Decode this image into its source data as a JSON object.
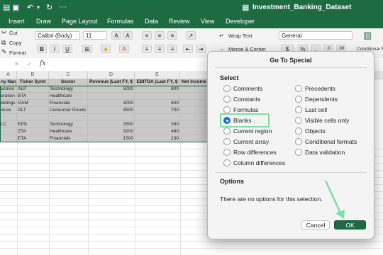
{
  "window": {
    "title": "Investment_Banking_Dataset"
  },
  "menu": [
    "Insert",
    "Draw",
    "Page Layout",
    "Formulas",
    "Data",
    "Review",
    "View",
    "Developer"
  ],
  "ribbon": {
    "clipboard": {
      "cut": "Cut",
      "copy": "Copy",
      "format": "Format"
    },
    "font_name": "Calibri (Body)",
    "font_size": "11",
    "bold": "B",
    "italic": "I",
    "underline": "U",
    "wrap_text": "Wrap Text",
    "merge_center": "Merge & Center",
    "number_format": "General",
    "percent": "%",
    "conditional_formatting": "Conditional Formatting"
  },
  "formula_bar": {
    "fx": "fx",
    "value": ""
  },
  "columns": [
    "A",
    "B",
    "C",
    "D",
    "E"
  ],
  "sheet": {
    "headers": [
      "ny Nan",
      "Ticker Symt",
      "Sector",
      "Revenue (Last FY, $",
      "EBITDA (Last FY, $",
      "Net Income"
    ],
    "rows": [
      [
        "ustries",
        "ALP",
        "Technology",
        "5000",
        "800",
        ""
      ],
      [
        "oration",
        "BTA",
        "Healthcare",
        "",
        "",
        ""
      ],
      [
        "oldings",
        "GAM",
        "Financials",
        "3000",
        "600",
        ""
      ],
      [
        "vices",
        "DLT",
        "Consumer Goods",
        "4500",
        "700",
        ""
      ],
      [
        "",
        "",
        "",
        "",
        "",
        ""
      ],
      [
        "LC",
        "EPS",
        "Technology",
        "2500",
        "390",
        ""
      ],
      [
        "",
        "ZTA",
        "Healthcare",
        "3200",
        "480",
        ""
      ],
      [
        "",
        "ETA",
        "Financials",
        "1500",
        "230",
        ""
      ]
    ]
  },
  "dialog": {
    "title": "Go To Special",
    "select_label": "Select",
    "left_options": [
      "Comments",
      "Constants",
      "Formulas",
      "Blanks",
      "Current region",
      "Current array",
      "Row differences",
      "Column differences"
    ],
    "right_options": [
      "Precedents",
      "Dependents",
      "Last cell",
      "Visible cells only",
      "Objects",
      "Conditional formats",
      "Data validation"
    ],
    "selected": "Blanks",
    "options_label": "Options",
    "options_text": "There are no options for this selection.",
    "cancel": "Cancel",
    "ok": "OK",
    "accent": "#1e6b42",
    "highlight": "#79e2a4"
  }
}
